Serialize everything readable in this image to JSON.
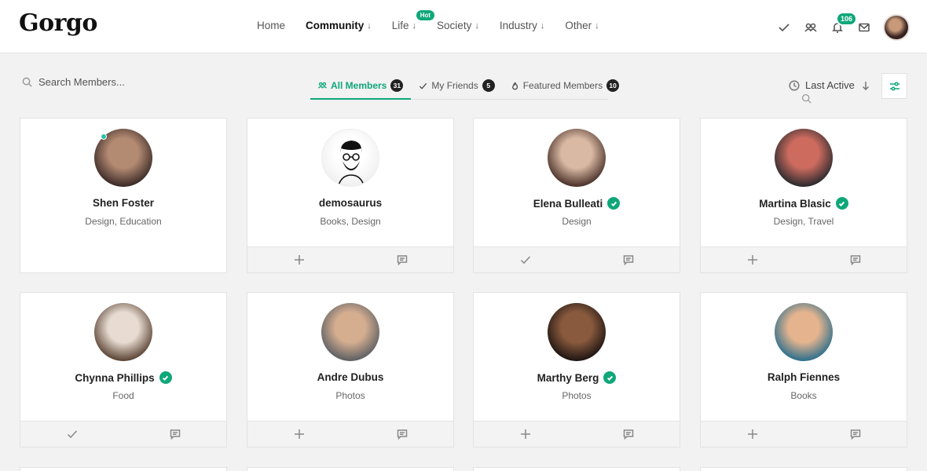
{
  "header": {
    "logo": "Gorgo",
    "nav": [
      {
        "label": "Home",
        "arrow": "",
        "active": false
      },
      {
        "label": "Community",
        "arrow": "↓",
        "active": true
      },
      {
        "label": "Life",
        "arrow": "↓",
        "active": false,
        "badge": "Hot"
      },
      {
        "label": "Society",
        "arrow": "↓",
        "active": false
      },
      {
        "label": "Industry",
        "arrow": "↓",
        "active": false
      },
      {
        "label": "Other",
        "arrow": "↓",
        "active": false
      }
    ],
    "notification_count": "106"
  },
  "toolbar": {
    "search_placeholder": "Search Members...",
    "tabs": [
      {
        "label": "All Members",
        "count": "31",
        "icon": "group-icon",
        "active": true
      },
      {
        "label": "My Friends",
        "count": "5",
        "icon": "check-icon",
        "active": false
      },
      {
        "label": "Featured Members",
        "count": "10",
        "icon": "flame-icon",
        "active": false
      }
    ],
    "sort_label": "Last Active"
  },
  "members": [
    {
      "name": "Shen Foster",
      "tags": "Design, Education",
      "verified": false,
      "online": true,
      "actions": [],
      "avatar_colors": [
        "#b38a72",
        "#3a2a26"
      ]
    },
    {
      "name": "demosaurus",
      "tags": "Books, Design",
      "verified": false,
      "online": false,
      "actions": [
        "add",
        "message"
      ],
      "avatar_colors": [
        "#ffffff",
        "#f0f0f0"
      ]
    },
    {
      "name": "Elena Bulleati",
      "tags": "Design",
      "verified": true,
      "online": false,
      "actions": [
        "friend",
        "message"
      ],
      "avatar_colors": [
        "#d9b9a3",
        "#4a3129"
      ]
    },
    {
      "name": "Martina Blasic",
      "tags": "Design, Travel",
      "verified": true,
      "online": false,
      "actions": [
        "add",
        "message"
      ],
      "avatar_colors": [
        "#cc6b5e",
        "#2a2a2e"
      ]
    },
    {
      "name": "Chynna Phillips",
      "tags": "Food",
      "verified": true,
      "online": false,
      "actions": [
        "friend",
        "message"
      ],
      "avatar_colors": [
        "#e8dcd2",
        "#5a4334"
      ]
    },
    {
      "name": "Andre Dubus",
      "tags": "Photos",
      "verified": false,
      "online": false,
      "actions": [
        "add",
        "message"
      ],
      "avatar_colors": [
        "#d5ae90",
        "#5d5f63"
      ]
    },
    {
      "name": "Marthy Berg",
      "tags": "Photos",
      "verified": true,
      "online": false,
      "actions": [
        "add",
        "message"
      ],
      "avatar_colors": [
        "#8a5a3e",
        "#1e1512"
      ]
    },
    {
      "name": "Ralph Fiennes",
      "tags": "Books",
      "verified": false,
      "online": false,
      "actions": [
        "add",
        "message"
      ],
      "avatar_colors": [
        "#e5b48e",
        "#2d6f8c"
      ]
    }
  ],
  "colors": {
    "accent": "#0fa779",
    "badge_dark": "#222222"
  }
}
